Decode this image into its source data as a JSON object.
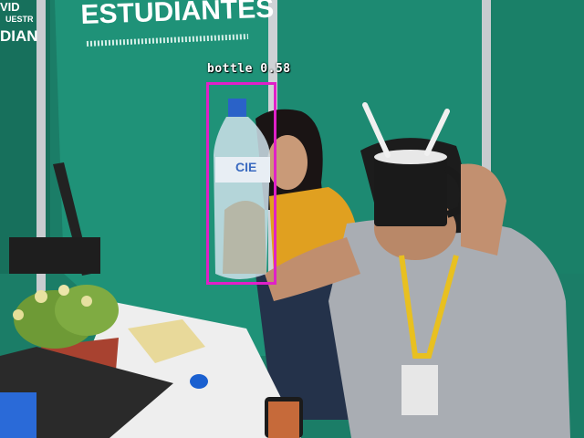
{
  "banner": {
    "main_text": "ESTUDIANTES",
    "left_fragment_top": "VID",
    "left_fragment_mid": "UESTR",
    "left_fragment_bottom": "DIAN"
  },
  "bottle_label_text": "CIE",
  "detections": [
    {
      "label": "bottle",
      "score": "0.58",
      "caption": "bottle 0.58",
      "color": "#e020c8"
    }
  ]
}
